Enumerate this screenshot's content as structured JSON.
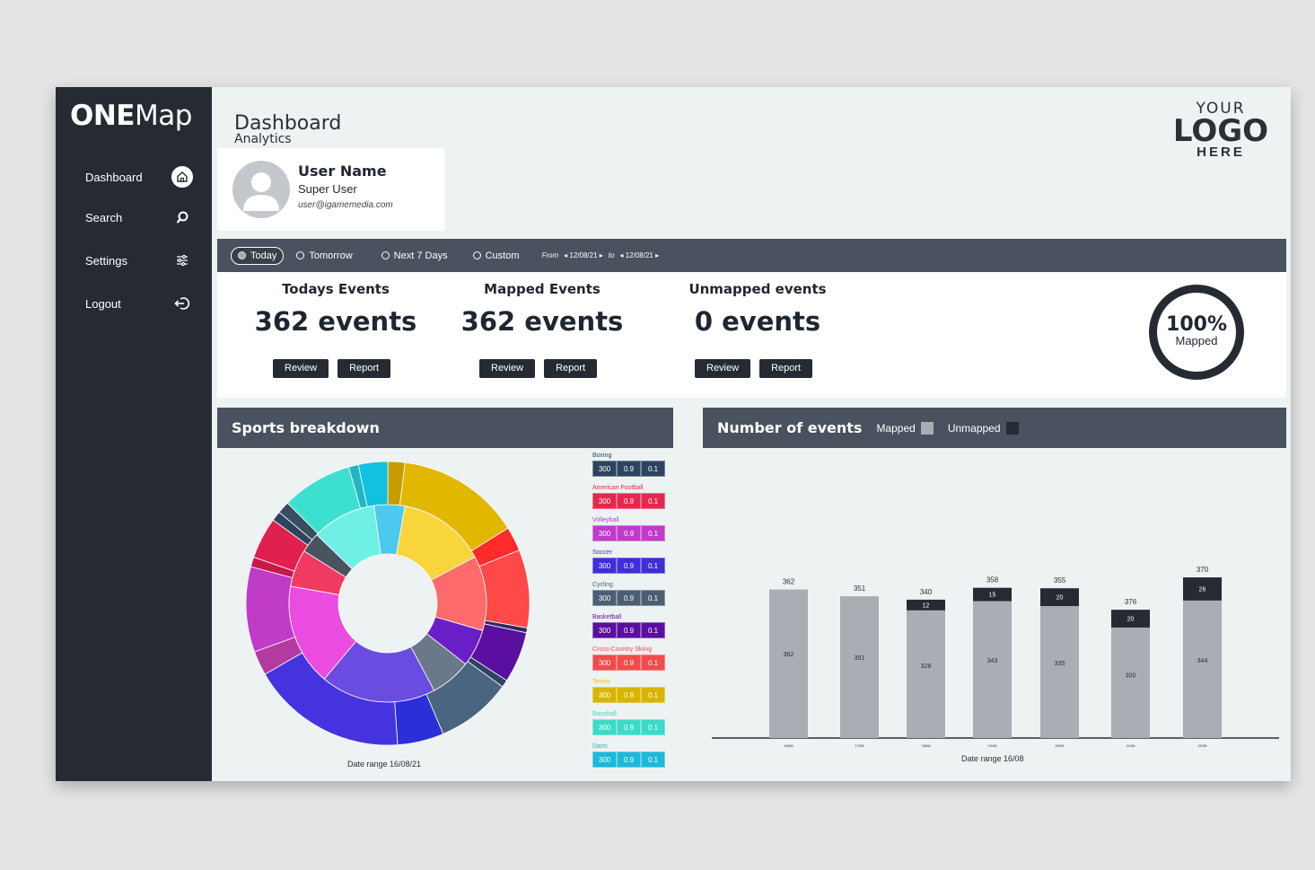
{
  "app": {
    "brand_bold": "ONE",
    "brand_light": "Map"
  },
  "sidebar": {
    "items": [
      {
        "label": "Dashboard",
        "icon": "home-icon",
        "active": true
      },
      {
        "label": "Search",
        "icon": "search-icon",
        "active": false
      },
      {
        "label": "Settings",
        "icon": "sliders-icon",
        "active": false
      },
      {
        "label": "Logout",
        "icon": "logout-icon",
        "active": false
      }
    ]
  },
  "header": {
    "title": "Dashboard",
    "subtitle": "Analytics",
    "logo_line1": "YOUR",
    "logo_line2": "LOGO",
    "logo_line3": "HERE"
  },
  "user": {
    "name": "User Name",
    "role": "Super User",
    "email": "user@igamemedia.com"
  },
  "filters": {
    "options": [
      "Today",
      "Tomorrow",
      "Next 7 Days",
      "Custom"
    ],
    "selected": "Today",
    "from_label": "From",
    "from_date": "12/08/21",
    "to_label": "to",
    "to_date": "12/08/21"
  },
  "stats": [
    {
      "title": "Todays Events",
      "value": "362 events",
      "review": "Review",
      "report": "Report"
    },
    {
      "title": "Mapped Events",
      "value": "362 events",
      "review": "Review",
      "report": "Report"
    },
    {
      "title": "Unmapped events",
      "value": "0 events",
      "review": "Review",
      "report": "Report"
    }
  ],
  "mapped_ring": {
    "value": "100%",
    "label": "Mapped",
    "fraction": 1.0
  },
  "sports": {
    "title": "Sports breakdown",
    "caption": "Date range  16/08/21",
    "items": [
      {
        "name": "Boxing",
        "cells": [
          "300",
          "0.9",
          "0.1"
        ],
        "color": "#2d4460",
        "text_color": "#2d4460"
      },
      {
        "name": "American Football",
        "cells": [
          "300",
          "0.9",
          "0.1"
        ],
        "color": "#e5284f",
        "text_color": "#e5284f"
      },
      {
        "name": "Volleyball",
        "cells": [
          "300",
          "0.9",
          "0.1"
        ],
        "color": "#c03bc8",
        "text_color": "#c03bc8"
      },
      {
        "name": "Soccer",
        "cells": [
          "300",
          "0.9",
          "0.1"
        ],
        "color": "#3f2fd6",
        "text_color": "#3f2fd6"
      },
      {
        "name": "Cycling",
        "cells": [
          "300",
          "0.9",
          "0.1"
        ],
        "color": "#4b5e74",
        "text_color": "#4b5e74"
      },
      {
        "name": "Basketball",
        "cells": [
          "300",
          "0.9",
          "0.1"
        ],
        "color": "#5a0fa0",
        "text_color": "#5a0fa0"
      },
      {
        "name": "Cross-Country Skiing",
        "cells": [
          "300",
          "0.9",
          "0.1"
        ],
        "color": "#f24b4b",
        "text_color": "#f24b4b"
      },
      {
        "name": "Tennis",
        "cells": [
          "300",
          "0.9",
          "0.1"
        ],
        "color": "#d9b400",
        "text_color": "#e8c900"
      },
      {
        "name": "Baseball",
        "cells": [
          "300",
          "0.9",
          "0.1"
        ],
        "color": "#3ed9c8",
        "text_color": "#3ed9c8"
      },
      {
        "name": "Darts",
        "cells": [
          "300",
          "0.9",
          "0.1"
        ],
        "color": "#1eb8d8",
        "text_color": "#1eb8d8"
      }
    ]
  },
  "events_chart": {
    "title": "Number of events",
    "legend_mapped": "Mapped",
    "legend_unmapped": "Unmapped",
    "caption": "Date range 16/08"
  },
  "chart_data": {
    "type": "bar",
    "stacked": true,
    "categories": [
      "16/08",
      "17/08",
      "18/08",
      "19/08",
      "20/08",
      "21/08",
      "22/08"
    ],
    "series": [
      {
        "name": "Mapped",
        "values": [
          362,
          351,
          328,
          343,
          335,
          300,
          344
        ],
        "color": "#a9adb4"
      },
      {
        "name": "Unmapped",
        "values": [
          0,
          0,
          12,
          15,
          20,
          20,
          26
        ],
        "color": "#262b33"
      }
    ],
    "totals": [
      362,
      351,
      340,
      358,
      355,
      376,
      370
    ],
    "xlabel": "",
    "ylabel": "",
    "grid": false
  }
}
